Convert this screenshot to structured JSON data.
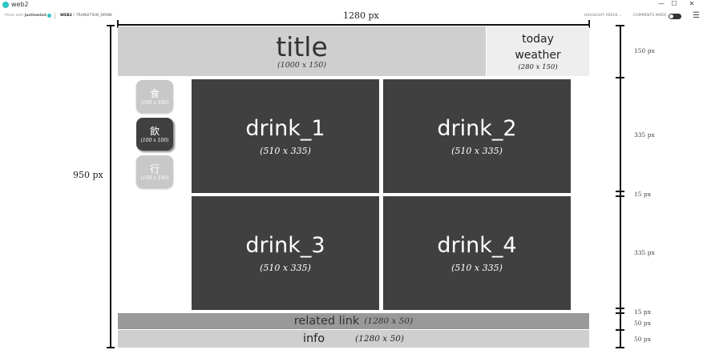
{
  "window": {
    "app_title": "web2",
    "minimize": "—",
    "maximize": "☐",
    "close": "✕"
  },
  "toolbar": {
    "made_with_prefix": "Made with",
    "made_with_brand": "justinmind",
    "breadcrumb_project": "WEB2",
    "breadcrumb_sep": " / ",
    "breadcrumb_screen": "TRANSITION_DRINK",
    "highlight_label": "HIGHLIGHT AREAS ⌄",
    "comments_label": "COMMENTS MODE",
    "menu_icon": "☰"
  },
  "dimensions": {
    "width": "1280 px",
    "height": "950 px",
    "right": [
      "150 px",
      "335 px",
      "15 px",
      "335 px",
      "15 px",
      "50 px",
      "50 px"
    ]
  },
  "header": {
    "title": "title",
    "title_size": "(1000 x 150)",
    "weather": "today\nweather",
    "weather_line1": "today",
    "weather_line2": "weather",
    "weather_size": "(280 x 150)"
  },
  "sidebar": [
    {
      "label": "食",
      "size": "(100 x 100)",
      "active": false
    },
    {
      "label": "飲",
      "size": "(100 x 100)",
      "active": true
    },
    {
      "label": "行",
      "size": "(100 x 100)",
      "active": false
    }
  ],
  "drinks": [
    {
      "name": "drink_1",
      "size": "(510 x 335)"
    },
    {
      "name": "drink_2",
      "size": "(510 x 335)"
    },
    {
      "name": "drink_3",
      "size": "(510 x 335)"
    },
    {
      "name": "drink_4",
      "size": "(510 x 335)"
    }
  ],
  "footer": {
    "related_label": "related link",
    "related_size": "(1280 x 50)",
    "info_label": "info",
    "info_size": "(1280 x 50)"
  },
  "colors": {
    "dark_block": "#404040",
    "title_block": "#cfcfcf",
    "related_block": "#999999",
    "brand": "#2ec4c4"
  }
}
